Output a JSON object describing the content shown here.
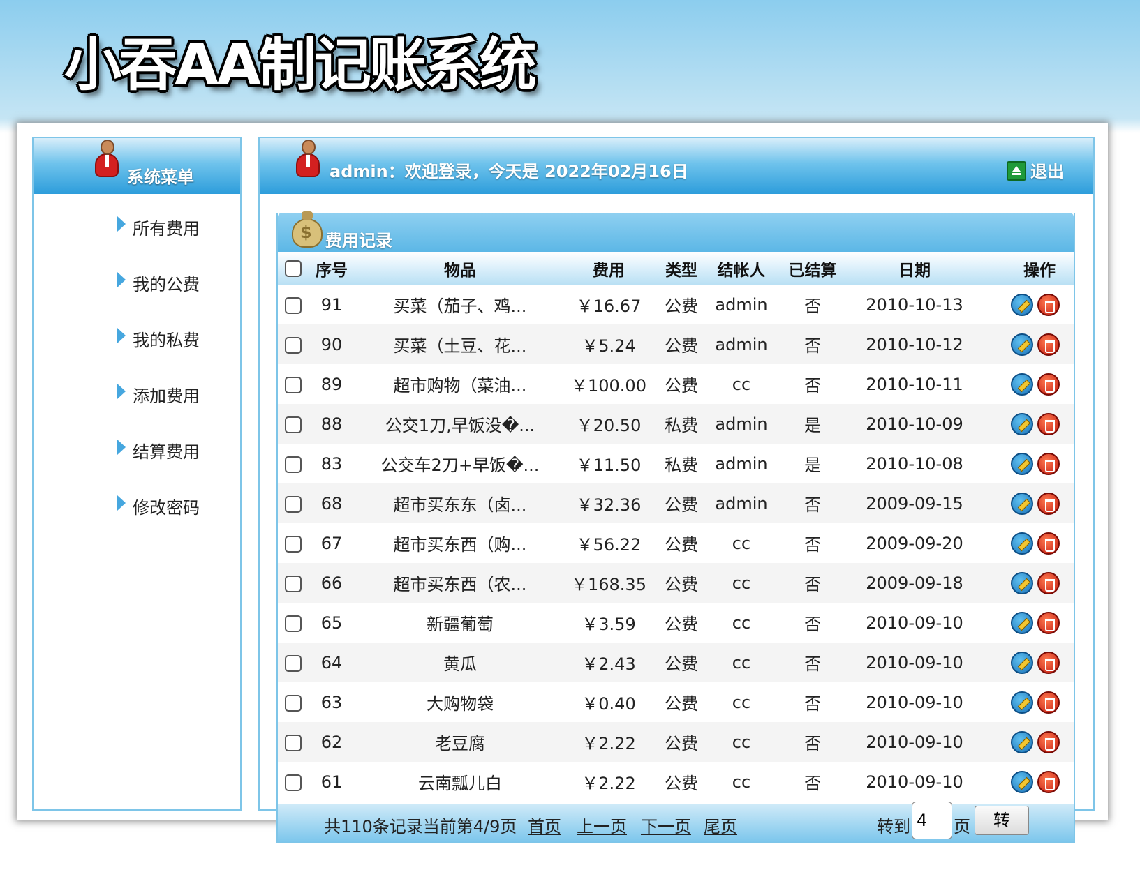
{
  "app": {
    "title": "小吞AA制记账系统"
  },
  "sidebar": {
    "title": "系统菜单",
    "items": [
      {
        "label": "所有费用"
      },
      {
        "label": "我的公费"
      },
      {
        "label": "我的私费"
      },
      {
        "label": "添加费用"
      },
      {
        "label": "结算费用"
      },
      {
        "label": "修改密码"
      }
    ]
  },
  "header": {
    "welcome": "admin：欢迎登录，今天是 2022年02月16日",
    "logout_label": "退出"
  },
  "records": {
    "title": "费用记录",
    "columns": [
      "序号",
      "物品",
      "费用",
      "类型",
      "结帐人",
      "已结算",
      "日期",
      "操作"
    ],
    "rows": [
      {
        "id": "91",
        "item": "买菜（茄子、鸡...",
        "cost": "￥16.67",
        "type": "公费",
        "payer": "admin",
        "settled": "否",
        "date": "2010-10-13"
      },
      {
        "id": "90",
        "item": "买菜（土豆、花...",
        "cost": "￥5.24",
        "type": "公费",
        "payer": "admin",
        "settled": "否",
        "date": "2010-10-12"
      },
      {
        "id": "89",
        "item": "超市购物（菜油...",
        "cost": "￥100.00",
        "type": "公费",
        "payer": "cc",
        "settled": "否",
        "date": "2010-10-11"
      },
      {
        "id": "88",
        "item": "公交1刀,早饭没�...",
        "cost": "￥20.50",
        "type": "私费",
        "payer": "admin",
        "settled": "是",
        "date": "2010-10-09"
      },
      {
        "id": "83",
        "item": "公交车2刀+早饭�...",
        "cost": "￥11.50",
        "type": "私费",
        "payer": "admin",
        "settled": "是",
        "date": "2010-10-08"
      },
      {
        "id": "68",
        "item": "超市买东东（卤...",
        "cost": "￥32.36",
        "type": "公费",
        "payer": "admin",
        "settled": "否",
        "date": "2009-09-15"
      },
      {
        "id": "67",
        "item": "超市买东西（购...",
        "cost": "￥56.22",
        "type": "公费",
        "payer": "cc",
        "settled": "否",
        "date": "2009-09-20"
      },
      {
        "id": "66",
        "item": "超市买东西（农...",
        "cost": "￥168.35",
        "type": "公费",
        "payer": "cc",
        "settled": "否",
        "date": "2009-09-18"
      },
      {
        "id": "65",
        "item": "新疆葡萄",
        "cost": "￥3.59",
        "type": "公费",
        "payer": "cc",
        "settled": "否",
        "date": "2010-09-10"
      },
      {
        "id": "64",
        "item": "黄瓜",
        "cost": "￥2.43",
        "type": "公费",
        "payer": "cc",
        "settled": "否",
        "date": "2010-09-10"
      },
      {
        "id": "63",
        "item": "大购物袋",
        "cost": "￥0.40",
        "type": "公费",
        "payer": "cc",
        "settled": "否",
        "date": "2010-09-10"
      },
      {
        "id": "62",
        "item": "老豆腐",
        "cost": "￥2.22",
        "type": "公费",
        "payer": "cc",
        "settled": "否",
        "date": "2010-09-10"
      },
      {
        "id": "61",
        "item": "云南瓢儿白",
        "cost": "￥2.22",
        "type": "公费",
        "payer": "cc",
        "settled": "否",
        "date": "2010-09-10"
      }
    ]
  },
  "pagination": {
    "info": "共110条记录当前第4/9页",
    "first": "首页",
    "prev": "上一页",
    "next": "下一页",
    "last": "尾页",
    "goto_label": "转到",
    "goto_value": "4",
    "page_label": "页",
    "go_button": "转"
  },
  "colors": {
    "header_blue": "#2d9ddb",
    "border_blue": "#7ec5e8",
    "banner_top": "#8ccdee"
  }
}
